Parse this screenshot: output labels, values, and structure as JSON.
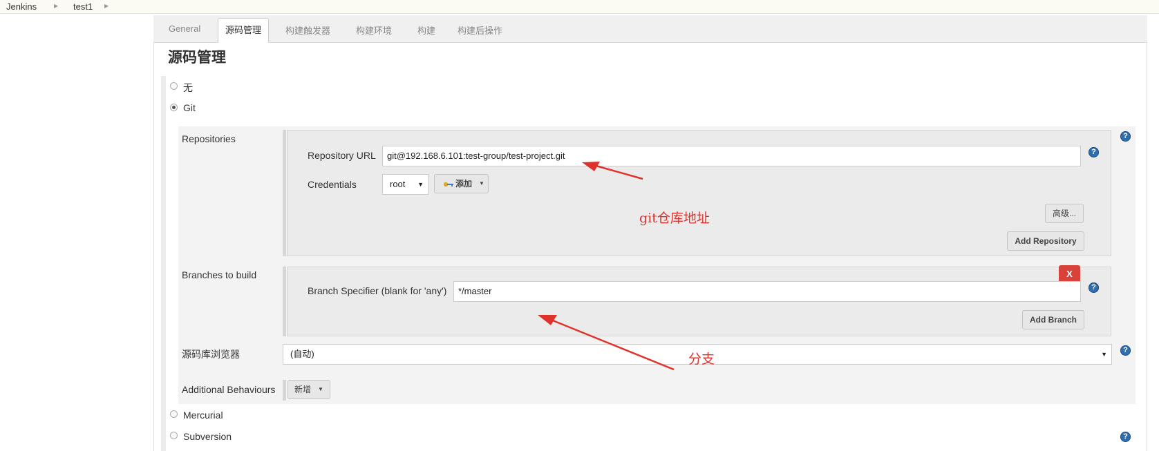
{
  "breadcrumb": {
    "items": [
      "Jenkins",
      "test1"
    ]
  },
  "tabs": [
    "General",
    "源码管理",
    "构建触发器",
    "构建环境",
    "构建",
    "构建后操作"
  ],
  "section_title": "源码管理",
  "scm": {
    "options": {
      "none": "无",
      "git": "Git",
      "mercurial": "Mercurial",
      "subversion": "Subversion"
    },
    "repositories": {
      "label": "Repositories",
      "url_label": "Repository URL",
      "url_value": "git@192.168.6.101:test-group/test-project.git",
      "credentials_label": "Credentials",
      "credentials_value": "root",
      "add_button": "添加",
      "advanced_button": "高级...",
      "add_repository_button": "Add Repository"
    },
    "branches": {
      "label": "Branches to build",
      "specifier_label": "Branch Specifier (blank for 'any')",
      "specifier_value": "*/master",
      "delete_button": "X",
      "add_branch_button": "Add Branch"
    },
    "browser": {
      "label": "源码库浏览器",
      "value": "(自动)"
    },
    "behaviours": {
      "label": "Additional Behaviours",
      "add_button": "新增"
    }
  },
  "annotations": {
    "repo_note": "git仓库地址",
    "branch_note": "分支"
  },
  "colors": {
    "annotation": "#e0322c",
    "help": "#2f6fb0",
    "delete": "#d9423a"
  },
  "icons": [
    "help-icon",
    "key-icon",
    "dropdown-caret-icon",
    "breadcrumb-arrow-icon"
  ]
}
